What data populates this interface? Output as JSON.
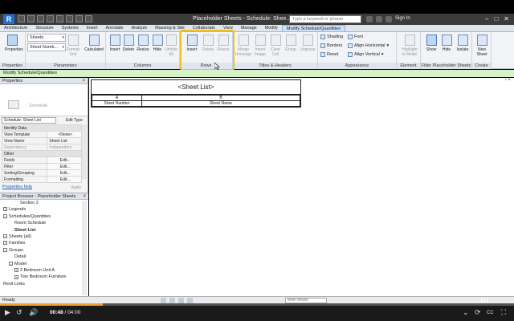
{
  "titlebar": {
    "logo_letter": "R",
    "title": "Placeholder Sheets - Schedule: Shee...",
    "search_placeholder": "Type a keyword or phrase",
    "signin": "Sign In",
    "controls": [
      "–",
      "□",
      "✕"
    ]
  },
  "tabs": [
    "Architecture",
    "Structure",
    "Systems",
    "Insert",
    "Annotate",
    "Analyze",
    "Massing & Site",
    "Collaborate",
    "View",
    "Manage",
    "Modify",
    "Modify Schedule/Quantities"
  ],
  "active_tab_index": 11,
  "ribbon": {
    "groups": [
      {
        "label": "Properties"
      },
      {
        "label": "Parameters"
      },
      {
        "label": "Columns"
      },
      {
        "label": "Rows"
      },
      {
        "label": "Titles & Headers"
      },
      {
        "label": "Appearance"
      },
      {
        "label": "Element"
      },
      {
        "label": "Filter Placeholder Sheets"
      },
      {
        "label": "Create"
      }
    ],
    "properties_btn": "Properties",
    "param_dd1": "Sheets",
    "param_dd2": "Sheet Numb...",
    "format_unit": "Format Unit",
    "calculated": "Calculated",
    "col_insert": "Insert",
    "col_delete": "Delete",
    "col_resize": "Resize",
    "col_hide": "Hide",
    "col_unhide": "Unhide All",
    "row_insert": "Insert",
    "row_delete": "Delete",
    "row_resize": "Resize",
    "th_merge": "Merge Unmerge",
    "th_insert_image": "Insert Image",
    "th_clear_cell": "Clear Cell",
    "th_group": "Group",
    "th_ungroup": "Ungroup",
    "ap_shading": "Shading",
    "ap_borders": "Borders",
    "ap_reset": "Reset",
    "ap_font": "Font",
    "ap_align_h": "Align Horizontal",
    "ap_align_v": "Align Vertical",
    "el_highlight": "Highlight in Model",
    "show": "Show",
    "hide": "Hide",
    "isolate": "Isolate",
    "new_sheet": "New Sheet"
  },
  "context_bar": "Modify Schedule/Quantities",
  "properties_panel": {
    "header": "Properties",
    "type_name": "Schedule",
    "selector": "Schedule: Sheet List",
    "edit_type": "Edit Type",
    "rows": [
      {
        "section": "Identity Data"
      },
      {
        "k": "View Template",
        "v": "<None>",
        "btn": true
      },
      {
        "k": "View Name",
        "v": "Sheet List"
      },
      {
        "k": "Dependency",
        "v": "Independent",
        "grey": true
      },
      {
        "section": "Other"
      },
      {
        "k": "Fields",
        "v": "Edit...",
        "btn": true
      },
      {
        "k": "Filter",
        "v": "Edit...",
        "btn": true
      },
      {
        "k": "Sorting/Grouping",
        "v": "Edit...",
        "btn": true
      },
      {
        "k": "Formatting",
        "v": "Edit...",
        "btn": true
      }
    ],
    "help_link": "Properties help",
    "apply": "Apply"
  },
  "project_browser": {
    "header": "Project Browser - Placeholder Sheets",
    "items": [
      {
        "label": "Section 2",
        "indent": 3,
        "box": ""
      },
      {
        "label": "Legends",
        "indent": 0,
        "box": "+"
      },
      {
        "label": "Schedules/Quantities",
        "indent": 0,
        "box": "–"
      },
      {
        "label": "Room Schedule",
        "indent": 2,
        "box": ""
      },
      {
        "label": "Sheet List",
        "indent": 2,
        "box": "",
        "bold": true
      },
      {
        "label": "Sheets (all)",
        "indent": 0,
        "box": "+"
      },
      {
        "label": "Families",
        "indent": 0,
        "box": "+"
      },
      {
        "label": "Groups",
        "indent": 0,
        "box": "–"
      },
      {
        "label": "Detail",
        "indent": 2,
        "box": ""
      },
      {
        "label": "Model",
        "indent": 1,
        "box": "–"
      },
      {
        "label": "2 Bedroom Unit A",
        "indent": 2,
        "box": "+"
      },
      {
        "label": "Two Bedroom Furniture",
        "indent": 2,
        "box": "+"
      },
      {
        "label": "Revit Links",
        "indent": 0,
        "box": ""
      }
    ]
  },
  "schedule": {
    "title": "<Sheet List>",
    "col_letters": [
      "A",
      "B"
    ],
    "col_headers": [
      "Sheet Number",
      "Sheet Name"
    ]
  },
  "statusbar": {
    "text": "Ready",
    "model": "Main Model"
  },
  "player": {
    "current_time": "00:48",
    "separator": "/",
    "duration": "04:00",
    "progress_fraction": 0.2
  },
  "watermark": "Linked in",
  "colors": {
    "accent": "#f0c020",
    "context_green": "#d6f2c8",
    "progress": "#f0a030"
  }
}
